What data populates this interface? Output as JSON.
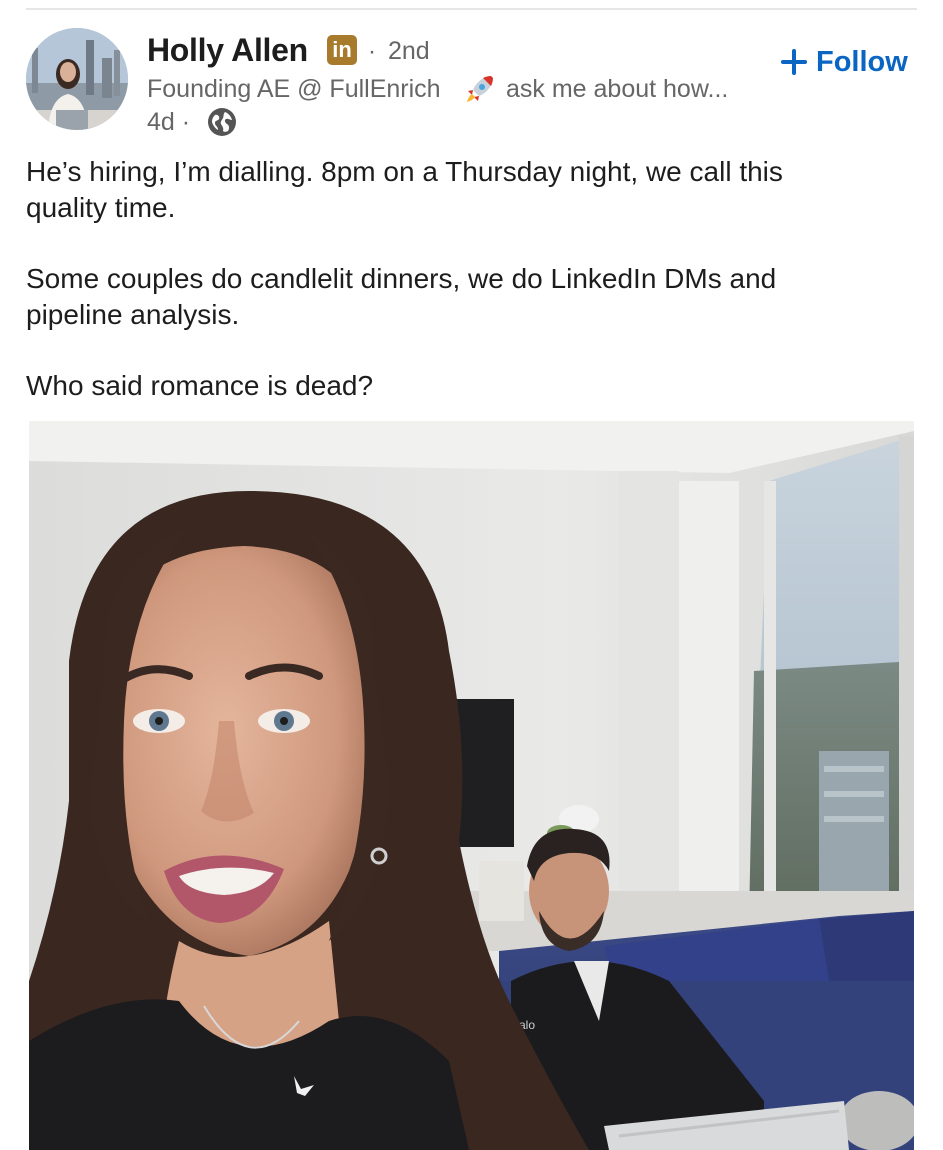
{
  "post": {
    "author": {
      "name": "Holly Allen",
      "badge": "in",
      "separator": "·",
      "degree": "2nd",
      "headline": "Founding AE @ FullEnrich",
      "headline_emoji": "rocket-icon",
      "headline_rest": "ask me about how...",
      "time": "4d",
      "time_separator": "·",
      "visibility_icon": "globe-icon"
    },
    "follow_label": "Follow",
    "text": {
      "p1_line1": "He’s hiring, I’m dialling. 8pm on a Thursday night, we call this",
      "p1_line2": "quality time.",
      "p2_line1": "Some couples do candlelit dinners, we do LinkedIn DMs and",
      "p2_line2": "pipeline analysis.",
      "p3": "Who said romance is dead?"
    },
    "photo_logo_text": "alo"
  },
  "colors": {
    "link_blue": "#0a66c2",
    "secondary_text": "#666666",
    "primary_text": "#1d1d1d",
    "premium_badge": "#a87b2c"
  }
}
